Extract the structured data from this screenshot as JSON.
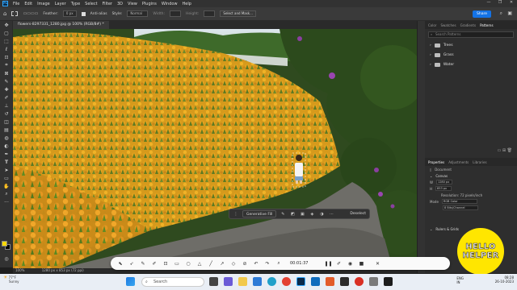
{
  "menubar": {
    "app_badge": "Ps",
    "items": [
      "File",
      "Edit",
      "Image",
      "Layer",
      "Type",
      "Select",
      "Filter",
      "3D",
      "View",
      "Plugins",
      "Window",
      "Help"
    ],
    "window_controls": [
      "—",
      "❐",
      "✕"
    ]
  },
  "options": {
    "feather_label": "Feather:",
    "feather_value": "0 px",
    "antialias_label": "Anti-alias",
    "style_label": "Style:",
    "style_value": "Normal",
    "width_label": "Width:",
    "height_label": "Height:",
    "select_mask": "Select and Mask...",
    "share": "Share"
  },
  "document": {
    "tab_title": "flowers-8297331_1280.jpg @ 100% (RGB/8#) *",
    "status": "100%",
    "status_size": "1280 px x 853 px (72 ppi)"
  },
  "context_bar": {
    "generative_fill": "Generative Fill",
    "deselect": "Deselect"
  },
  "right_panel": {
    "tabs_top": [
      "Color",
      "Swatches",
      "Gradients",
      "Patterns"
    ],
    "active_top": "Patterns",
    "search_placeholder": "Search Patterns",
    "folders": [
      "Trees",
      "Grass",
      "Water"
    ],
    "tabs_props": [
      "Properties",
      "Adjustments",
      "Libraries"
    ],
    "doc_label": "Document",
    "canvas_label": "Canvas",
    "w_label": "W",
    "w_value": "1280 px",
    "h_label": "H",
    "h_value": "853 px",
    "resolution": "Resolution: 72 pixels/inch",
    "mode_label": "Mode",
    "mode_value": "RGB Color",
    "depth_value": "8 Bits/Channel",
    "rulers": "Rulers & Grids"
  },
  "recorder": {
    "time": "00:01:37"
  },
  "taskbar": {
    "weather_temp": "77°F",
    "weather_desc": "Sunny",
    "search": "Search",
    "lang_1": "ENG",
    "lang_2": "IN",
    "time": "08:28",
    "date": "26-10-2023"
  },
  "watermark": {
    "line1": "HELLO",
    "line2": "HELPER",
    "color": "#ffe600"
  }
}
